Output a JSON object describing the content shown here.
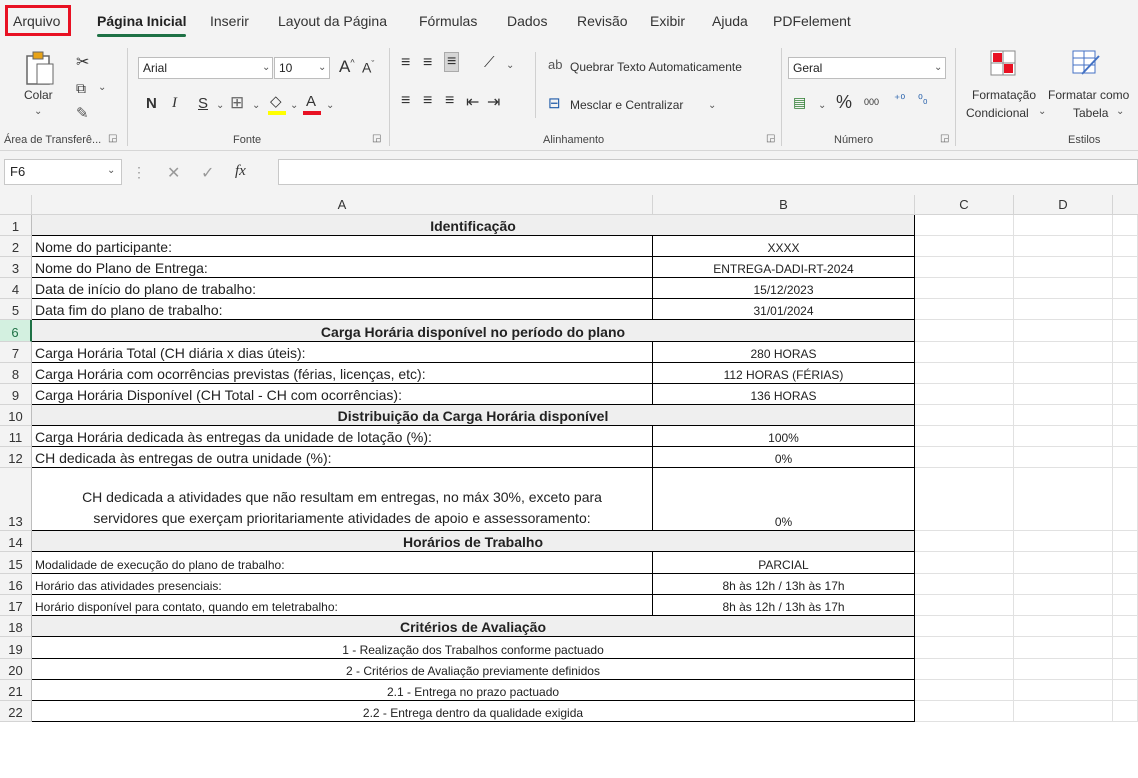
{
  "menu": {
    "items": [
      "Arquivo",
      "Página Inicial",
      "Inserir",
      "Layout da Página",
      "Fórmulas",
      "Dados",
      "Revisão",
      "Exibir",
      "Ajuda",
      "PDFelement"
    ]
  },
  "ribbon": {
    "clipboard": {
      "paste_label": "Colar",
      "group_label": "Área de Transferê..."
    },
    "font": {
      "name": "Arial",
      "size": "10",
      "bold": "N",
      "italic": "I",
      "underline": "S",
      "grow": "A",
      "shrink": "A",
      "color_letter": "A",
      "group_label": "Fonte"
    },
    "alignment": {
      "wrap_label": "Quebrar Texto Automaticamente",
      "merge_label": "Mesclar e Centralizar",
      "group_label": "Alinhamento"
    },
    "number": {
      "format": "Geral",
      "percent": "%",
      "thousands": "000",
      "group_label": "Número"
    },
    "styles": {
      "conditional_line1": "Formatação",
      "conditional_line2": "Condicional",
      "table_line1": "Formatar como",
      "table_line2": "Tabela",
      "group_label": "Estilos"
    }
  },
  "formula_bar": {
    "name_box": "F6",
    "fx": "fx",
    "formula": ""
  },
  "columns": [
    "A",
    "B",
    "C",
    "D"
  ],
  "rows": [
    {
      "n": "1",
      "a": "Identificação",
      "b": "",
      "type": "header"
    },
    {
      "n": "2",
      "a": "Nome do participante:",
      "b": "XXXX",
      "type": "data"
    },
    {
      "n": "3",
      "a": "Nome do Plano de Entrega:",
      "b": "ENTREGA-DADI-RT-2024",
      "type": "data"
    },
    {
      "n": "4",
      "a": "Data de início do plano de trabalho:",
      "b": "15/12/2023",
      "type": "data"
    },
    {
      "n": "5",
      "a": "Data fim do plano de trabalho:",
      "b": "31/01/2024",
      "type": "data"
    },
    {
      "n": "6",
      "a": "Carga Horária disponível no período do plano",
      "b": "",
      "type": "header"
    },
    {
      "n": "7",
      "a": "Carga Horária Total (CH diária x dias úteis):",
      "b": "280 HORAS",
      "type": "data"
    },
    {
      "n": "8",
      "a": "Carga Horária com ocorrências previstas (férias, licenças, etc):",
      "b": "112 HORAS (FÉRIAS)",
      "type": "data"
    },
    {
      "n": "9",
      "a": "Carga Horária Disponível (CH Total - CH com ocorrências):",
      "b": "136 HORAS",
      "type": "data"
    },
    {
      "n": "10",
      "a": "Distribuição da Carga Horária disponível",
      "b": "",
      "type": "header"
    },
    {
      "n": "11",
      "a": "Carga Horária dedicada às entregas da unidade de lotação (%):",
      "b": "100%",
      "type": "data"
    },
    {
      "n": "12",
      "a": "CH dedicada às entregas de outra unidade (%):",
      "b": "0%",
      "type": "data"
    },
    {
      "n": "13",
      "a": "CH dedicada a atividades que não resultam em entregas, no máx 30%, exceto para servidores que exerçam prioritariamente atividades de apoio e assessoramento:",
      "b": "0%",
      "type": "wrap"
    },
    {
      "n": "14",
      "a": "Horários de Trabalho",
      "b": "",
      "type": "header"
    },
    {
      "n": "15",
      "a": "Modalidade de execução do plano de trabalho:",
      "b": "PARCIAL",
      "type": "small"
    },
    {
      "n": "16",
      "a": "Horário das atividades presenciais:",
      "b": "8h às 12h / 13h às 17h",
      "type": "small"
    },
    {
      "n": "17",
      "a": "Horário disponível para contato, quando em teletrabalho:",
      "b": "8h às 12h / 13h às 17h",
      "type": "small"
    },
    {
      "n": "18",
      "a": "Critérios de Avaliação",
      "b": "",
      "type": "header"
    },
    {
      "n": "19",
      "a": "1 - Realização dos Trabalhos conforme pactuado",
      "b": "",
      "type": "merged"
    },
    {
      "n": "20",
      "a": "2 - Critérios de Avaliação previamente definidos",
      "b": "",
      "type": "merged"
    },
    {
      "n": "21",
      "a": "2.1 - Entrega no prazo pactuado",
      "b": "",
      "type": "merged"
    },
    {
      "n": "22",
      "a": "2.2 - Entrega dentro da qualidade exigida",
      "b": "",
      "type": "merged"
    }
  ]
}
